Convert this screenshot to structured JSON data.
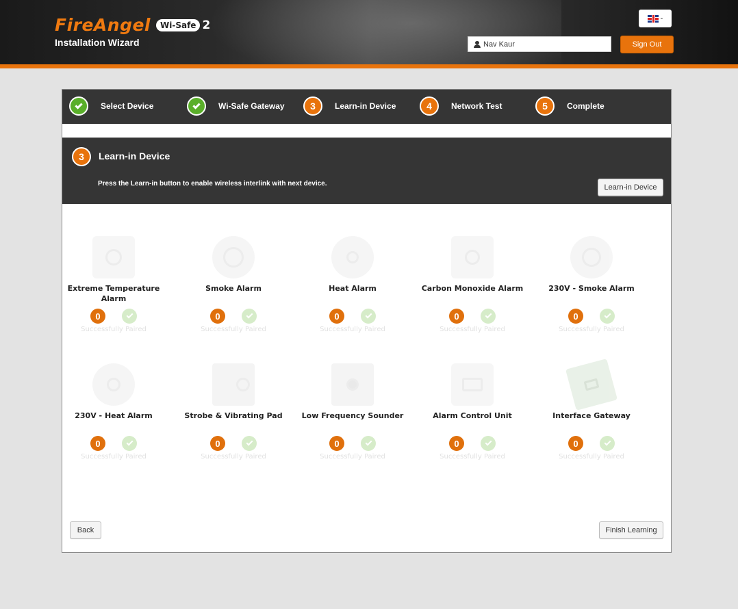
{
  "header": {
    "brand_name": "FireAngel",
    "brand_sub": "Wi-Safe",
    "brand_num": "2",
    "wizard_title": "Installation Wizard",
    "language_caret": "-",
    "user_name": "Nav Kaur",
    "sign_out": "Sign Out",
    "accent_color": "#e8730c"
  },
  "steps": [
    {
      "state": "done",
      "label": "Select Device"
    },
    {
      "state": "done",
      "label": "Wi-Safe Gateway"
    },
    {
      "state": "current",
      "number": "3",
      "label": "Learn-in Device"
    },
    {
      "state": "pending",
      "number": "4",
      "label": "Network Test"
    },
    {
      "state": "pending",
      "number": "5",
      "label": "Complete"
    }
  ],
  "section": {
    "number": "3",
    "title": "Learn-in Device",
    "description": "Press the Learn-in button to enable wireless interlink with next device.",
    "learn_button": "Learn-in Device"
  },
  "devices": [
    {
      "name": "Extreme Temperature Alarm",
      "count": "0",
      "status": "Successfully Paired"
    },
    {
      "name": "Smoke Alarm",
      "count": "0",
      "status": "Successfully Paired"
    },
    {
      "name": "Heat Alarm",
      "count": "0",
      "status": "Successfully Paired"
    },
    {
      "name": "Carbon Monoxide Alarm",
      "count": "0",
      "status": "Successfully Paired"
    },
    {
      "name": "230V - Smoke Alarm",
      "count": "0",
      "status": "Successfully Paired"
    },
    {
      "name": "230V - Heat Alarm",
      "count": "0",
      "status": "Successfully Paired"
    },
    {
      "name": "Strobe & Vibrating Pad",
      "count": "0",
      "status": "Successfully Paired"
    },
    {
      "name": "Low Frequency Sounder",
      "count": "0",
      "status": "Successfully Paired"
    },
    {
      "name": "Alarm Control Unit",
      "count": "0",
      "status": "Successfully Paired"
    },
    {
      "name": "Interface Gateway",
      "count": "0",
      "status": "Successfully Paired"
    }
  ],
  "footer": {
    "back": "Back",
    "finish": "Finish Learning"
  }
}
